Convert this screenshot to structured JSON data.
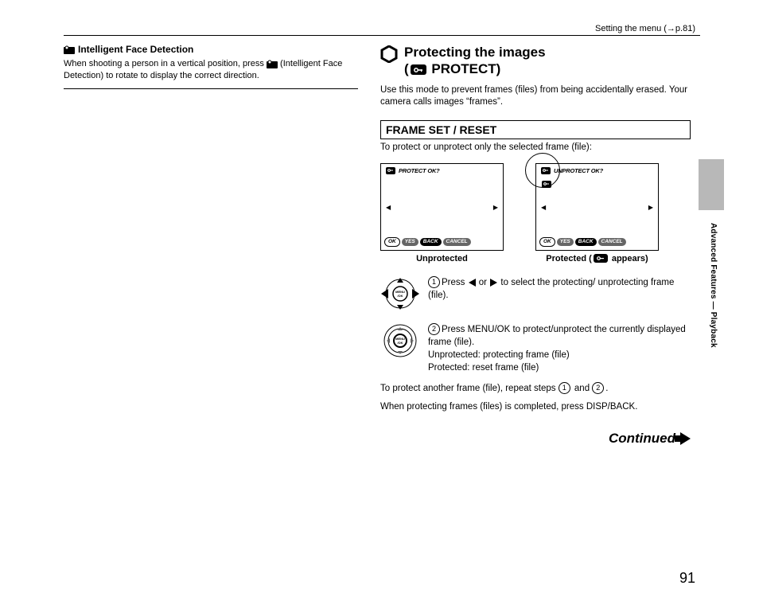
{
  "header": {
    "ref_text": "Setting the menu (→p.81)"
  },
  "left": {
    "tip_title": "Intelligent Face Detection",
    "tip_body_a": "When shooting a person in a vertical position, press ",
    "tip_body_b": " (Intelligent Face Detection) to rotate to display the correct direction."
  },
  "right": {
    "title_line1": "Protecting the images",
    "title_line2_a": "(",
    "title_line2_b": " PROTECT)",
    "intro": "Use this mode to prevent frames (files) from being accidentally erased. Your camera calls images “frames”.",
    "subhead": "FRAME SET / RESET",
    "subintro": "To protect or unprotect only the selected frame (file):",
    "screens": {
      "left_prompt": "PROTECT OK?",
      "right_prompt": "UNPROTECT OK?",
      "ok": "OK",
      "yes": "YES",
      "back": "BACK",
      "cancel": "CANCEL",
      "label_left": "Unprotected",
      "label_right_a": "Protected (",
      "label_right_b": " appears)"
    },
    "steps": {
      "s1_a": "Press ",
      "s1_b": " or ",
      "s1_c": " to select the protecting/ unprotecting frame (file).",
      "s2_a": "Press MENU/OK to protect/unprotect the currently displayed frame (file).",
      "s2_b": "Unprotected: protecting frame (file)",
      "s2_c": "Protected: reset frame (file)"
    },
    "after_a": "To protect another frame (file), repeat steps ",
    "after_mid": " and ",
    "after_end": ".",
    "after2": "When protecting frames (files) is completed, press DISP/BACK.",
    "continued": "Continued"
  },
  "side": {
    "text": "Advanced Features — Playback"
  },
  "page_number": "91"
}
